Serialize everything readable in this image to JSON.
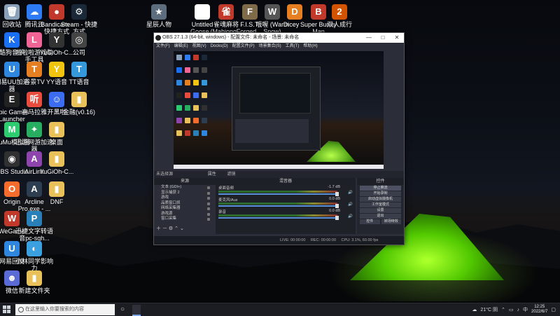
{
  "desktop_icons": [
    {
      "name": "recycle-bin",
      "label": "回收站",
      "color": "#8aa0b8",
      "glyph": "🗑"
    },
    {
      "name": "tencent-cloud",
      "label": "腾讯云",
      "color": "#2d7cf6",
      "glyph": "☁"
    },
    {
      "name": "bandicam",
      "label": "Bandicam - 快捷方式",
      "color": "#c0392b",
      "glyph": "●"
    },
    {
      "name": "steam",
      "label": "Steam - 快捷方式",
      "color": "#1b2838",
      "glyph": "⚙"
    },
    {
      "name": "kuwo",
      "label": "酷狗音乐",
      "color": "#1a6ff2",
      "glyph": "K"
    },
    {
      "name": "lala",
      "label": "啦啦啦游戏助手工具",
      "color": "#f06595",
      "glyph": "L"
    },
    {
      "name": "yugioh",
      "label": "YuGiOh-C...",
      "color": "#333",
      "glyph": "Y"
    },
    {
      "name": "gongzhan",
      "label": "公司",
      "color": "#444",
      "glyph": "◎"
    },
    {
      "name": "netbar",
      "label": "网易UU加速器",
      "color": "#2e86de",
      "glyph": "U"
    },
    {
      "name": "gumu",
      "label": "谷景TV",
      "color": "#e67e22",
      "glyph": "T"
    },
    {
      "name": "yy",
      "label": "YY语音",
      "color": "#f1c40f",
      "glyph": "Y"
    },
    {
      "name": "tt",
      "label": "TT语音",
      "color": "#3498db",
      "glyph": "T"
    },
    {
      "name": "epic",
      "label": "Epic Games Launcher",
      "color": "#222",
      "glyph": "E"
    },
    {
      "name": "ting",
      "label": "喜马拉雅",
      "color": "#e74c3c",
      "glyph": "听"
    },
    {
      "name": "kaishe",
      "label": "开黑啦",
      "color": "#3c6df0",
      "glyph": "☺"
    },
    {
      "name": "folder1",
      "label": "金融(v0.16)",
      "color": "#e8c15a",
      "glyph": "▮"
    },
    {
      "name": "mumu",
      "label": "MuMu模拟器",
      "color": "#2ecc71",
      "glyph": "M"
    },
    {
      "name": "xunyou",
      "label": "迅游网游加速器",
      "color": "#27ae60",
      "glyph": "✦"
    },
    {
      "name": "desktop",
      "label": "桌面",
      "color": "#e8c15a",
      "glyph": "▮"
    },
    {
      "name": "obs",
      "label": "OBS Studio",
      "color": "#303030",
      "glyph": "◉"
    },
    {
      "name": "airlink",
      "label": "AirLink",
      "color": "#8e44ad",
      "glyph": "A"
    },
    {
      "name": "yugioh2",
      "label": "YuGiOh-C...",
      "color": "#e8c15a",
      "glyph": "▮"
    },
    {
      "name": "origin",
      "label": "Origin",
      "color": "#f56c2d",
      "glyph": "O"
    },
    {
      "name": "arcline",
      "label": "Arcline Pro.exe - ...",
      "color": "#2c3e50",
      "glyph": "A"
    },
    {
      "name": "dnf",
      "label": "DNF",
      "color": "#e8c15a",
      "glyph": "▮"
    },
    {
      "name": "wegame",
      "label": "WeGame",
      "color": "#c0392b",
      "glyph": "W"
    },
    {
      "name": "xunlei",
      "label": "迅捷文字转语音pc-sgh...",
      "color": "#2980b9",
      "glyph": "P"
    },
    {
      "name": "netease",
      "label": "网易回旋",
      "color": "#2e86de",
      "glyph": "U"
    },
    {
      "name": "xiaohongshu",
      "label": "小林同学影响力",
      "color": "#3aa0e0",
      "glyph": "◐"
    },
    {
      "name": "caigou",
      "label": "微信",
      "color": "#5b6bd6",
      "glyph": "☻"
    },
    {
      "name": "newfolder",
      "label": "新建文件夹",
      "color": "#e8c15a",
      "glyph": "▮"
    },
    {
      "name": "top-game1",
      "label": "星辰人物",
      "color": "#5d6d7e",
      "glyph": "★"
    },
    {
      "name": "top-game2",
      "label": "Untitled Goose...",
      "color": "#fff",
      "glyph": "▲"
    },
    {
      "name": "top-game3",
      "label": "雀魂麻将 (Mahjong...",
      "color": "#c0392b",
      "glyph": "雀"
    },
    {
      "name": "top-game4",
      "label": "F.I.S.T. Forged ...",
      "color": "#7f6a4a",
      "glyph": "F"
    },
    {
      "name": "top-game5",
      "label": "哦喔 (Warm Snow)",
      "color": "#555",
      "glyph": "W"
    },
    {
      "name": "top-game6",
      "label": "Dicey ...",
      "color": "#e67e22",
      "glyph": "D"
    },
    {
      "name": "top-game7",
      "label": "Super Bunny Man",
      "color": "#c0392b",
      "glyph": "B"
    },
    {
      "name": "top-game8",
      "label": "双人成行",
      "color": "#d35400",
      "glyph": "2"
    }
  ],
  "obs": {
    "title": "OBS 27.1.3 (64-bit, windows) - 配置文件: 未命名 - 场景: 未命名",
    "menu": [
      "文件(F)",
      "编辑(E)",
      "视图(V)",
      "Docks(D)",
      "配置文件(P)",
      "场景集合(S)",
      "工具(T)",
      "帮助(H)"
    ],
    "status_line": "未选择源",
    "properties": "属性",
    "filters": "滤镜",
    "docks": {
      "scenes_header": "来源",
      "audio_header": "混音器",
      "controls_header": "控件"
    },
    "sources": [
      "文本 (GDI+)",
      "显示捕获 2",
      "游戏",
      "品质窗口抓",
      "网络采集器",
      "游戏源",
      "窗口采集"
    ],
    "audio_channels": [
      {
        "name": "桌面音频",
        "db": "-1.7 dB"
      },
      {
        "name": "麦克风/Aux",
        "db": "0.0 dB"
      },
      {
        "name": "录音",
        "db": "0.0 dB"
      }
    ],
    "controls": [
      "停止推流",
      "开始录制",
      "启动虚拟摄像机",
      "工作室模式",
      "设置",
      "退出"
    ],
    "bottom_buttons": [
      "控件",
      "转场特效"
    ],
    "statusbar": {
      "live": "LIVE: 00:00:00",
      "rec": "REC: 00:00:00",
      "cpu": "CPU: 3.1%, 60.00 fps"
    }
  },
  "taskbar": {
    "search_placeholder": "在这里输入你要搜索的内容",
    "weather": "21°C 阴",
    "ime": "中",
    "time": "12:25",
    "date": "2022/6/7"
  }
}
